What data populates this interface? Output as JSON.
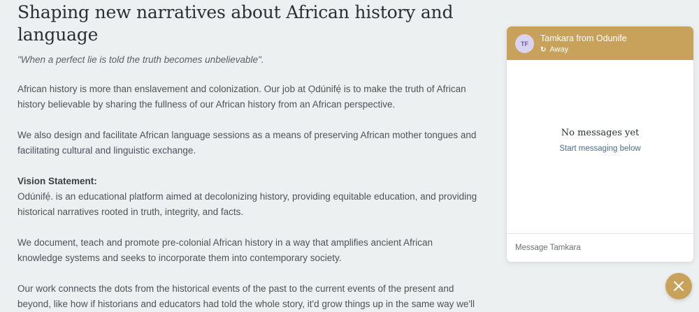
{
  "page": {
    "title": "Shaping new narratives about African history and language",
    "quote": "\"When a perfect lie is told the truth becomes unbelievable\".",
    "paragraph_1": "African history is more than enslavement and colonization. Our job at Ọdúnifẹ́ is to make the truth of African history believable by sharing the fullness of our African history from an African perspective.",
    "paragraph_2": "We also design and facilitate African language sessions as a means of preserving African mother tongues and facilitating cultural and linguistic exchange.",
    "vision_heading": "Vision Statement:",
    "vision_body": "Odúnifẹ́. is an educational platform aimed at decolonizing history, providing equitable education, and providing historical narratives rooted in truth, integrity, and facts.",
    "paragraph_4": "We document, teach and promote pre-colonial African history in a way that amplifies ancient African knowledge systems and seeks to incorporate them into contemporary society.",
    "paragraph_5": "Our work connects the dots from the historical events of the past to the current events of the present and beyond, like how if historians and educators had told the whole story, it'd grow things up in the same way we'll"
  },
  "chat": {
    "avatar_initials": "TF",
    "agent_name": "Tamkara from Odunife",
    "status": "Away",
    "empty_title": "No messages yet",
    "empty_subtitle": "Start messaging below",
    "input_placeholder": "Message Tamkara",
    "accent_color": "#c8a15a"
  },
  "icons": {
    "status": "refresh-icon",
    "launcher": "close-icon"
  }
}
